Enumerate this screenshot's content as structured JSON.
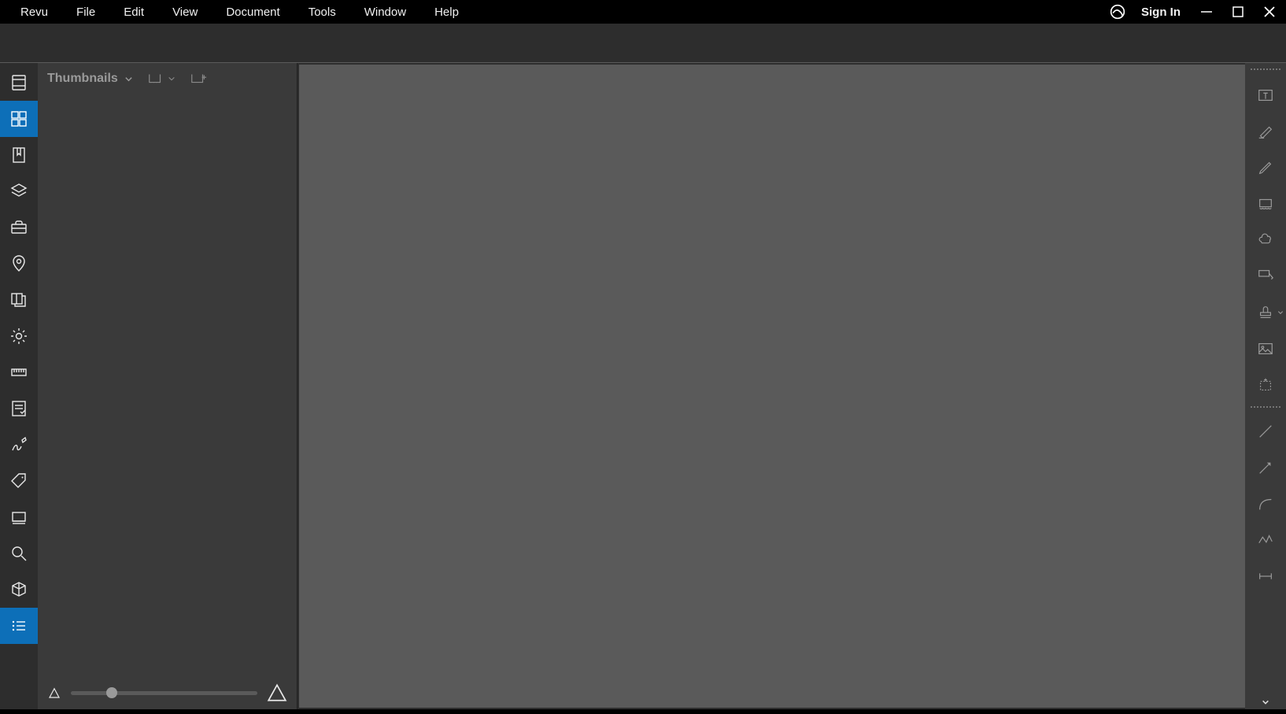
{
  "menu": {
    "items": [
      "Revu",
      "File",
      "Edit",
      "View",
      "Document",
      "Tools",
      "Window",
      "Help"
    ],
    "sign_in": "Sign In"
  },
  "panel": {
    "title": "Thumbnails"
  },
  "left_rail": {
    "items": [
      {
        "name": "file-access-icon"
      },
      {
        "name": "thumbnails-icon",
        "active": true
      },
      {
        "name": "bookmarks-icon"
      },
      {
        "name": "layers-icon"
      },
      {
        "name": "tool-chest-icon"
      },
      {
        "name": "places-icon"
      },
      {
        "name": "sets-icon"
      },
      {
        "name": "settings-icon"
      },
      {
        "name": "measurements-icon"
      },
      {
        "name": "forms-icon"
      },
      {
        "name": "signatures-icon"
      },
      {
        "name": "tags-icon"
      },
      {
        "name": "studio-icon"
      },
      {
        "name": "search-icon"
      },
      {
        "name": "3d-icon"
      },
      {
        "name": "properties-icon",
        "active": true
      }
    ]
  },
  "right_rail": {
    "items": [
      {
        "name": "text-box-icon",
        "framed": true
      },
      {
        "name": "highlight-icon"
      },
      {
        "name": "pen-icon"
      },
      {
        "name": "cloud-rect-icon"
      },
      {
        "name": "cloud-icon"
      },
      {
        "name": "callout-icon"
      },
      {
        "name": "stamp-icon",
        "chev": true
      },
      {
        "name": "image-icon"
      },
      {
        "name": "snapshot-icon"
      }
    ],
    "items2": [
      {
        "name": "line-icon"
      },
      {
        "name": "arrow-icon"
      },
      {
        "name": "arc-icon"
      },
      {
        "name": "polyline-icon"
      },
      {
        "name": "dimension-icon"
      }
    ]
  },
  "colors": {
    "accent": "#0d6fb8",
    "bg_dark": "#2d2d2d",
    "bg_panel": "#3a3a3a",
    "bg_canvas": "#5a5a5a"
  }
}
